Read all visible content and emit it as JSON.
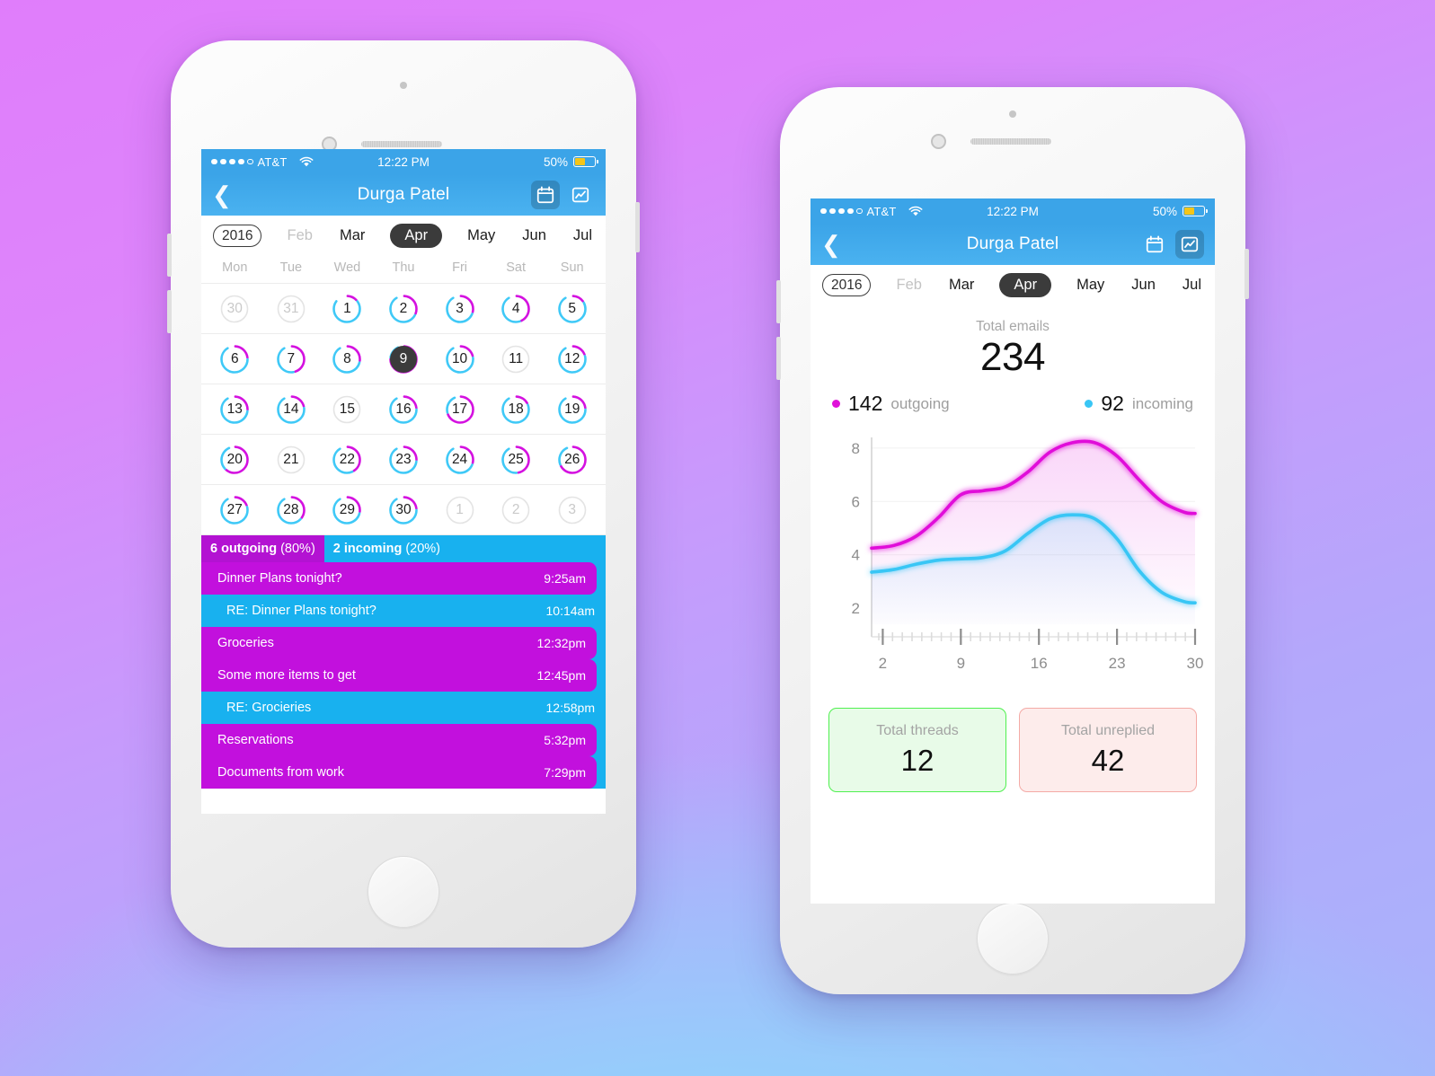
{
  "background": {
    "top_color": "#e07dfb",
    "bottom_color": "#8fd6fb"
  },
  "phone_left": {
    "status_bar": {
      "carrier": "AT&T",
      "signal_dots_filled": 4,
      "signal_dots_total": 5,
      "wifi_icon": "wifi-icon",
      "time": "12:22 PM",
      "battery_percent": "50%",
      "battery_level": 50
    },
    "nav": {
      "back_icon": "chevron-left-icon",
      "title": "Durga Patel",
      "calendar_icon": "calendar-icon",
      "chart_icon": "line-chart-icon",
      "active_icon": "calendar-icon"
    },
    "month_strip": {
      "year": "2016",
      "months": [
        {
          "label": "Feb",
          "state": "dim"
        },
        {
          "label": "Mar",
          "state": "normal"
        },
        {
          "label": "Apr",
          "state": "selected"
        },
        {
          "label": "May",
          "state": "normal"
        },
        {
          "label": "Jun",
          "state": "normal"
        },
        {
          "label": "Jul",
          "state": "normal"
        }
      ]
    },
    "calendar": {
      "day_headers": [
        "Mon",
        "Tue",
        "Wed",
        "Thu",
        "Fri",
        "Sat",
        "Sun"
      ],
      "weeks": [
        [
          {
            "day": "30",
            "outside": true,
            "out_pct": 0,
            "in_pct": 0
          },
          {
            "day": "31",
            "outside": true,
            "out_pct": 0,
            "in_pct": 0
          },
          {
            "day": "1",
            "outside": false,
            "out_pct": 12,
            "in_pct": 70
          },
          {
            "day": "2",
            "outside": false,
            "out_pct": 30,
            "in_pct": 58
          },
          {
            "day": "3",
            "outside": false,
            "out_pct": 28,
            "in_pct": 60
          },
          {
            "day": "4",
            "outside": false,
            "out_pct": 42,
            "in_pct": 46
          },
          {
            "day": "5",
            "outside": false,
            "out_pct": 14,
            "in_pct": 74
          }
        ],
        [
          {
            "day": "6",
            "outside": false,
            "out_pct": 22,
            "in_pct": 66
          },
          {
            "day": "7",
            "outside": false,
            "out_pct": 44,
            "in_pct": 44
          },
          {
            "day": "8",
            "outside": false,
            "out_pct": 26,
            "in_pct": 62
          },
          {
            "day": "9",
            "outside": false,
            "out_pct": 74,
            "in_pct": 16,
            "selected": true
          },
          {
            "day": "10",
            "outside": false,
            "out_pct": 20,
            "in_pct": 68
          },
          {
            "day": "11",
            "outside": false,
            "out_pct": 0,
            "in_pct": 0
          },
          {
            "day": "12",
            "outside": false,
            "out_pct": 18,
            "in_pct": 70
          }
        ],
        [
          {
            "day": "13",
            "outside": false,
            "out_pct": 24,
            "in_pct": 64
          },
          {
            "day": "14",
            "outside": false,
            "out_pct": 20,
            "in_pct": 68
          },
          {
            "day": "15",
            "outside": false,
            "out_pct": 0,
            "in_pct": 0
          },
          {
            "day": "16",
            "outside": false,
            "out_pct": 22,
            "in_pct": 66
          },
          {
            "day": "17",
            "outside": false,
            "out_pct": 68,
            "in_pct": 22
          },
          {
            "day": "18",
            "outside": false,
            "out_pct": 16,
            "in_pct": 72
          },
          {
            "day": "19",
            "outside": false,
            "out_pct": 22,
            "in_pct": 66
          }
        ],
        [
          {
            "day": "20",
            "outside": false,
            "out_pct": 60,
            "in_pct": 30
          },
          {
            "day": "21",
            "outside": false,
            "out_pct": 0,
            "in_pct": 0
          },
          {
            "day": "22",
            "outside": false,
            "out_pct": 40,
            "in_pct": 48
          },
          {
            "day": "23",
            "outside": false,
            "out_pct": 24,
            "in_pct": 64
          },
          {
            "day": "24",
            "outside": false,
            "out_pct": 28,
            "in_pct": 60
          },
          {
            "day": "25",
            "outside": false,
            "out_pct": 46,
            "in_pct": 42
          },
          {
            "day": "26",
            "outside": false,
            "out_pct": 66,
            "in_pct": 24
          }
        ],
        [
          {
            "day": "27",
            "outside": false,
            "out_pct": 18,
            "in_pct": 70
          },
          {
            "day": "28",
            "outside": false,
            "out_pct": 34,
            "in_pct": 54
          },
          {
            "day": "29",
            "outside": false,
            "out_pct": 26,
            "in_pct": 62
          },
          {
            "day": "30",
            "outside": false,
            "out_pct": 22,
            "in_pct": 66
          },
          {
            "day": "1",
            "outside": true,
            "out_pct": 0,
            "in_pct": 0
          },
          {
            "day": "2",
            "outside": true,
            "out_pct": 0,
            "in_pct": 0
          },
          {
            "day": "3",
            "outside": true,
            "out_pct": 0,
            "in_pct": 0
          }
        ]
      ]
    },
    "split_header": {
      "outgoing_count": "6 outgoing",
      "outgoing_pct": "(80%)",
      "incoming_count": "2 incoming",
      "incoming_pct": "(20%)"
    },
    "messages": [
      {
        "subject": "Dinner Plans tonight?",
        "time": "9:25am",
        "direction": "out"
      },
      {
        "subject": "RE: Dinner Plans tonight?",
        "time": "10:14am",
        "direction": "in"
      },
      {
        "subject": "Groceries",
        "time": "12:32pm",
        "direction": "out"
      },
      {
        "subject": "Some more items to get",
        "time": "12:45pm",
        "direction": "out"
      },
      {
        "subject": "RE: Grocieries",
        "time": "12:58pm",
        "direction": "in"
      },
      {
        "subject": "Reservations",
        "time": "5:32pm",
        "direction": "out"
      },
      {
        "subject": "Documents from work",
        "time": "7:29pm",
        "direction": "out"
      }
    ]
  },
  "phone_right": {
    "status_bar": {
      "carrier": "AT&T",
      "signal_dots_filled": 4,
      "signal_dots_total": 5,
      "wifi_icon": "wifi-icon",
      "time": "12:22 PM",
      "battery_percent": "50%",
      "battery_level": 50
    },
    "nav": {
      "back_icon": "chevron-left-icon",
      "title": "Durga Patel",
      "calendar_icon": "calendar-icon",
      "chart_icon": "line-chart-icon",
      "active_icon": "line-chart-icon"
    },
    "month_strip": {
      "year": "2016",
      "months": [
        {
          "label": "Feb",
          "state": "dim"
        },
        {
          "label": "Mar",
          "state": "normal"
        },
        {
          "label": "Apr",
          "state": "selected"
        },
        {
          "label": "May",
          "state": "normal"
        },
        {
          "label": "Jun",
          "state": "normal"
        },
        {
          "label": "Jul",
          "state": "normal"
        }
      ]
    },
    "total": {
      "label": "Total emails",
      "value": "234"
    },
    "legend": [
      {
        "value": "142",
        "caption": "outgoing",
        "color": "#e011d9"
      },
      {
        "value": "92",
        "caption": "incoming",
        "color": "#39c6f5"
      }
    ],
    "cards": [
      {
        "label": "Total threads",
        "value": "12",
        "style": "green"
      },
      {
        "label": "Total unreplied",
        "value": "42",
        "style": "red"
      }
    ],
    "chart_data": {
      "type": "line",
      "title": "",
      "xlabel": "",
      "ylabel": "",
      "xlim": [
        1,
        30
      ],
      "ylim": [
        1.4,
        8.6
      ],
      "xticks": [
        2,
        9,
        16,
        23,
        30
      ],
      "xtick_labels": [
        "2",
        "9",
        "16",
        "23",
        "30"
      ],
      "yticks": [
        2,
        4,
        6,
        8
      ],
      "ytick_labels": [
        "2",
        "4",
        "6",
        "8"
      ],
      "grid": "horizontal",
      "legend_position": "above-chart",
      "minor_ticks_per_interval": 7,
      "series": [
        {
          "name": "outgoing",
          "color": "#e011d9",
          "fill": true,
          "x": [
            1,
            3,
            5,
            7,
            9,
            11,
            13,
            15,
            17,
            19,
            21,
            23,
            25,
            27,
            29,
            30
          ],
          "y": [
            4.25,
            4.35,
            4.7,
            5.4,
            6.25,
            6.4,
            6.55,
            7.1,
            7.85,
            8.2,
            8.2,
            7.7,
            6.8,
            6.0,
            5.6,
            5.55
          ]
        },
        {
          "name": "incoming",
          "color": "#39c6f5",
          "fill": true,
          "x": [
            1,
            3,
            5,
            7,
            9,
            11,
            13,
            15,
            17,
            19,
            21,
            23,
            25,
            27,
            29,
            30
          ],
          "y": [
            3.35,
            3.45,
            3.65,
            3.8,
            3.85,
            3.9,
            4.15,
            4.8,
            5.35,
            5.5,
            5.35,
            4.6,
            3.4,
            2.6,
            2.25,
            2.2
          ]
        }
      ]
    }
  }
}
